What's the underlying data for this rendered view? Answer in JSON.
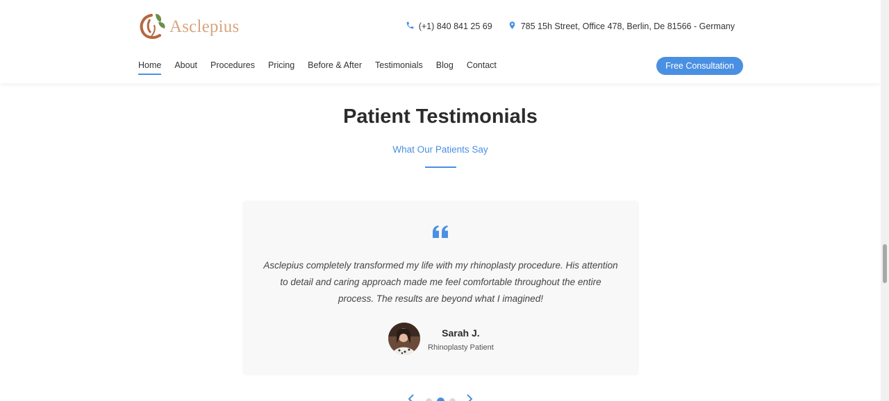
{
  "header": {
    "logo_text": "Asclepius",
    "phone": "(+1) 840 841 25 69",
    "address": "785 15h Street, Office 478, Berlin, De 81566 - Germany",
    "nav": [
      {
        "label": "Home",
        "active": true
      },
      {
        "label": "About"
      },
      {
        "label": "Procedures"
      },
      {
        "label": "Pricing"
      },
      {
        "label": "Before & After"
      },
      {
        "label": "Testimonials"
      },
      {
        "label": "Blog"
      },
      {
        "label": "Contact"
      }
    ],
    "cta_label": "Free Consultation"
  },
  "testimonials": {
    "title": "Patient Testimonials",
    "subtitle": "What Our Patients Say",
    "quote": "Asclepius completely transformed my life with my rhinoplasty procedure. His attention to detail and caring approach made me feel comfortable throughout the entire process. The results are beyond what I imagined!",
    "author_name": "Sarah J.",
    "author_role": "Rhinoplasty Patient",
    "carousel": {
      "dots": 3,
      "active_index": 1
    }
  },
  "colors": {
    "accent": "#4a90e2",
    "logo": "#d8a57e",
    "card_bg": "#f8f8f8"
  },
  "icons": [
    "logo-icon",
    "phone-icon",
    "location-pin-icon",
    "quote-icon",
    "chevron-left-icon",
    "chevron-right-icon"
  ]
}
